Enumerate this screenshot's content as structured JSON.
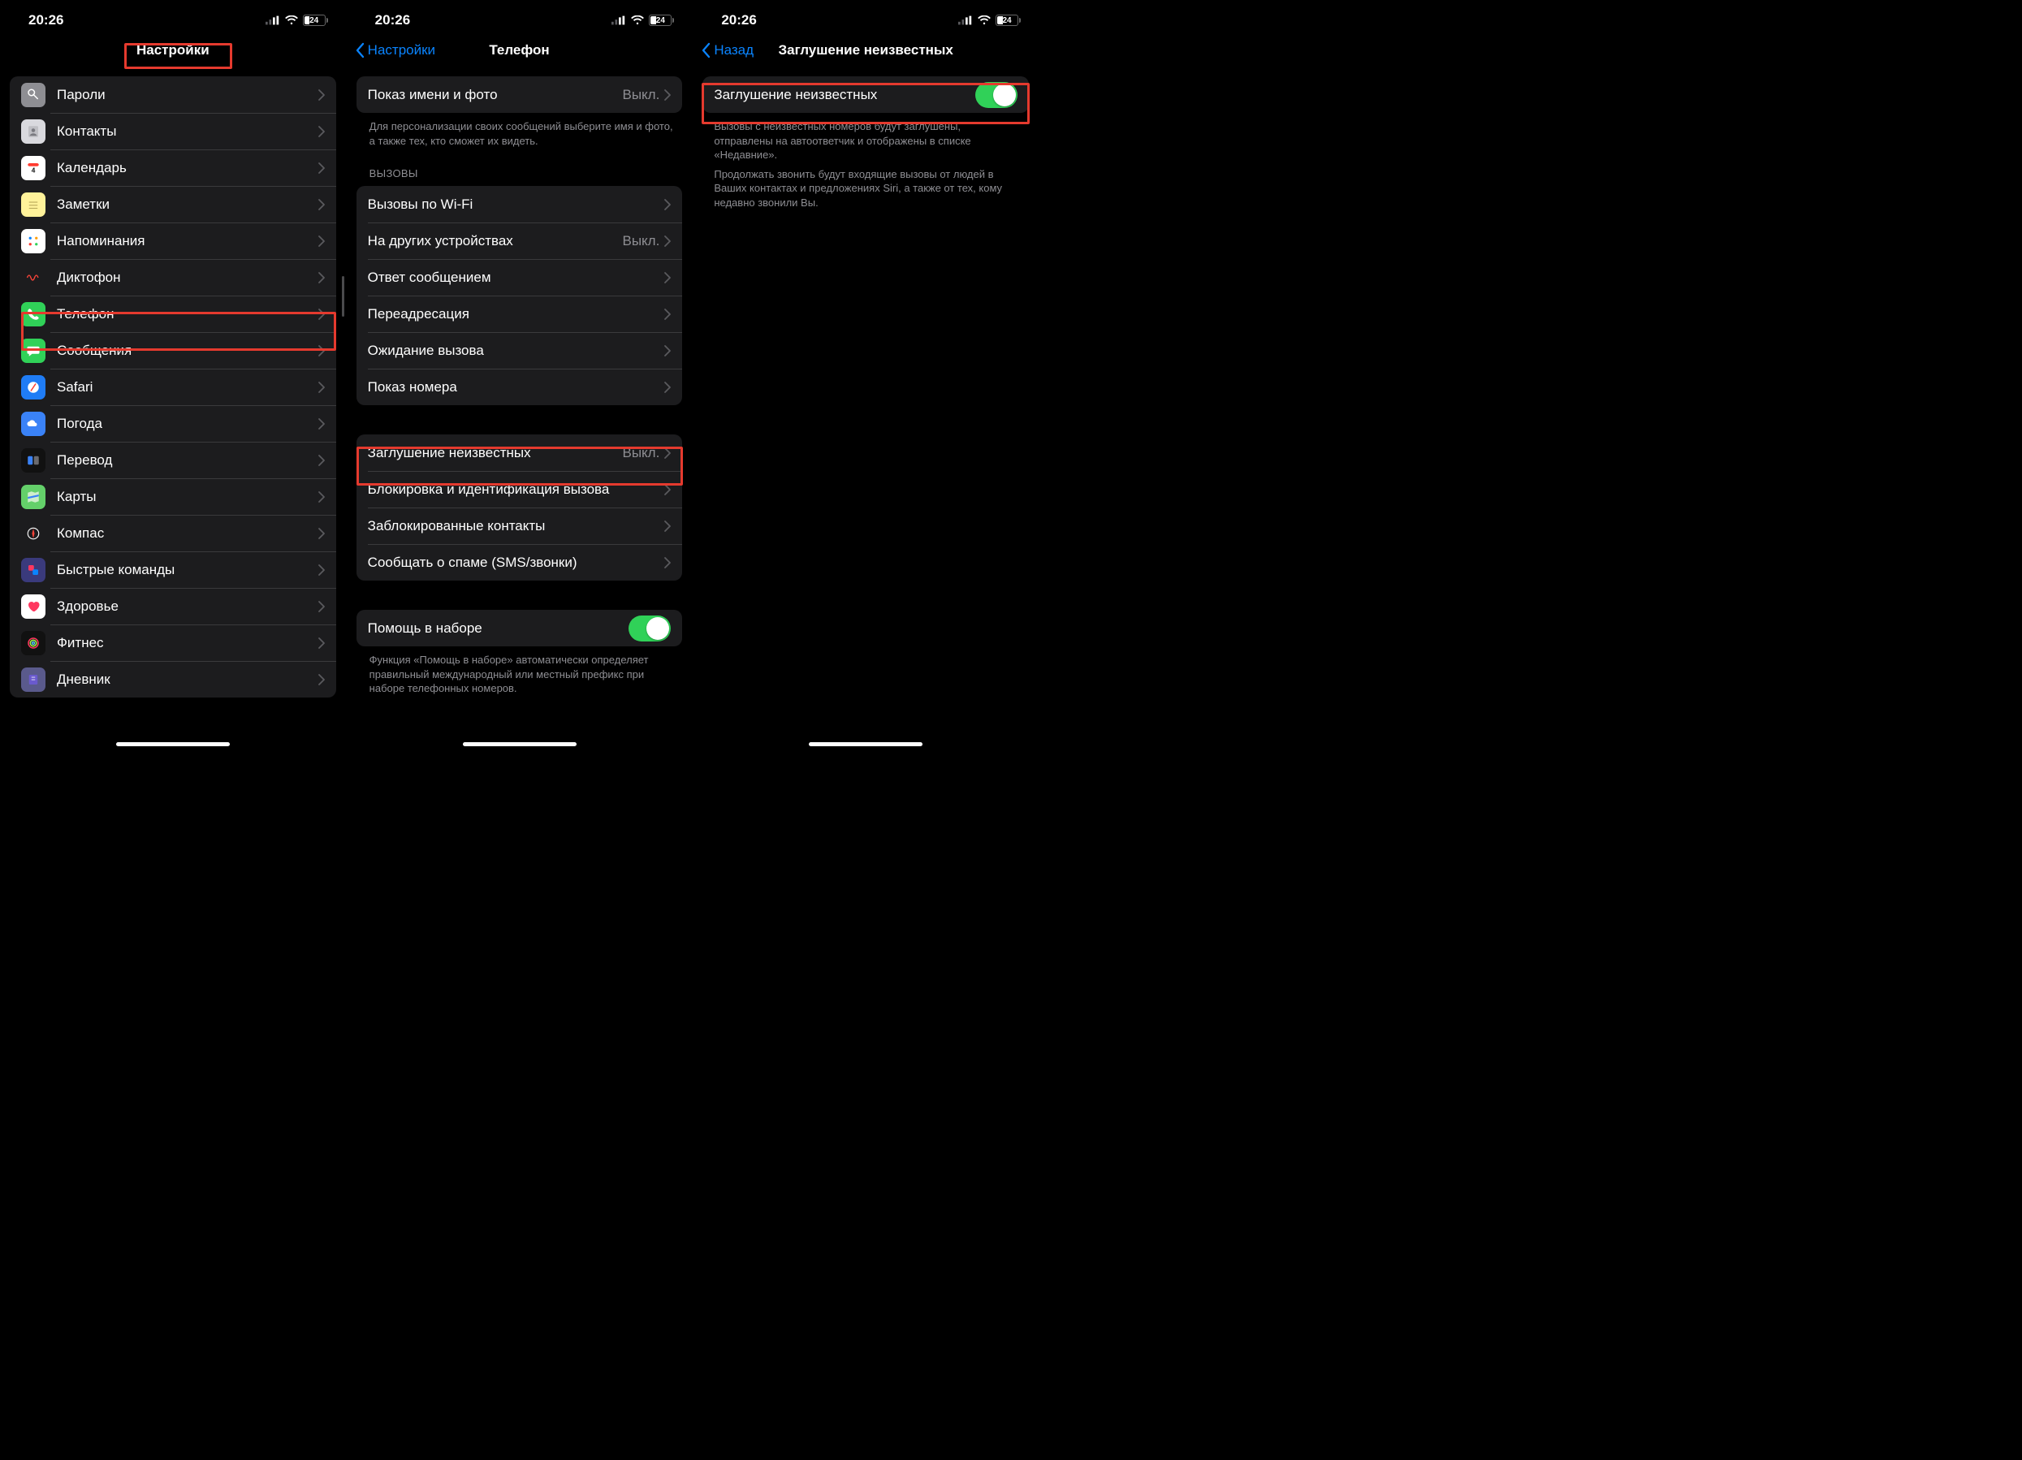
{
  "status": {
    "time": "20:26",
    "battery": "24"
  },
  "screen1": {
    "title": "Настройки",
    "items": [
      {
        "id": "passwords",
        "label": "Пароли",
        "bg": "#8e8e93"
      },
      {
        "id": "contacts",
        "label": "Контакты",
        "bg": "#d9d9de"
      },
      {
        "id": "calendar",
        "label": "Календарь",
        "bg": "#ffffff"
      },
      {
        "id": "notes",
        "label": "Заметки",
        "bg": "#fff29a"
      },
      {
        "id": "reminders",
        "label": "Напоминания",
        "bg": "#ffffff"
      },
      {
        "id": "voicememos",
        "label": "Диктофон",
        "bg": "#1c1c1e"
      },
      {
        "id": "phone",
        "label": "Телефон",
        "bg": "#30d158"
      },
      {
        "id": "messages",
        "label": "Сообщения",
        "bg": "#30d158"
      },
      {
        "id": "safari",
        "label": "Safari",
        "bg": "#1f7cf5"
      },
      {
        "id": "weather",
        "label": "Погода",
        "bg": "#3a82f7"
      },
      {
        "id": "translate",
        "label": "Перевод",
        "bg": "#111111"
      },
      {
        "id": "maps",
        "label": "Карты",
        "bg": "#64d06a"
      },
      {
        "id": "compass",
        "label": "Компас",
        "bg": "#1c1c1e"
      },
      {
        "id": "shortcuts",
        "label": "Быстрые команды",
        "bg": "#3a3a7c"
      },
      {
        "id": "health",
        "label": "Здоровье",
        "bg": "#ffffff"
      },
      {
        "id": "fitness",
        "label": "Фитнес",
        "bg": "#111111"
      },
      {
        "id": "journal",
        "label": "Дневник",
        "bg": "#5a5a8c"
      }
    ]
  },
  "screen2": {
    "back": "Настройки",
    "title": "Телефон",
    "group1": [
      {
        "label": "Показ имени и фото",
        "value": "Выкл."
      }
    ],
    "group1_footer": "Для персонализации своих сообщений выберите имя и фото, а также тех, кто сможет их видеть.",
    "calls_header": "ВЫЗОВЫ",
    "calls": [
      {
        "label": "Вызовы по Wi-Fi",
        "value": ""
      },
      {
        "label": "На других устройствах",
        "value": "Выкл."
      },
      {
        "label": "Ответ сообщением",
        "value": ""
      },
      {
        "label": "Переадресация",
        "value": ""
      },
      {
        "label": "Ожидание вызова",
        "value": ""
      },
      {
        "label": "Показ номера",
        "value": ""
      }
    ],
    "group3": [
      {
        "label": "Заглушение неизвестных",
        "value": "Выкл."
      },
      {
        "label": "Блокировка и идентификация вызова",
        "value": ""
      },
      {
        "label": "Заблокированные контакты",
        "value": ""
      },
      {
        "label": "Сообщать о спаме (SMS/звонки)",
        "value": ""
      }
    ],
    "dial_assist": {
      "label": "Помощь в наборе"
    },
    "dial_footer": "Функция «Помощь в наборе» автоматически определяет правильный международный или местный префикс при наборе телефонных номеров."
  },
  "screen3": {
    "back": "Назад",
    "title": "Заглушение неизвестных",
    "toggle_label": "Заглушение неизвестных",
    "footer1": "Вызовы с неизвестных номеров будут заглушены, отправлены на автоответчик и отображены в списке «Недавние».",
    "footer2": "Продолжать звонить будут входящие вызовы от людей в Ваших контактах и предложениях Siri, а также от тех, кому недавно звонили Вы."
  }
}
